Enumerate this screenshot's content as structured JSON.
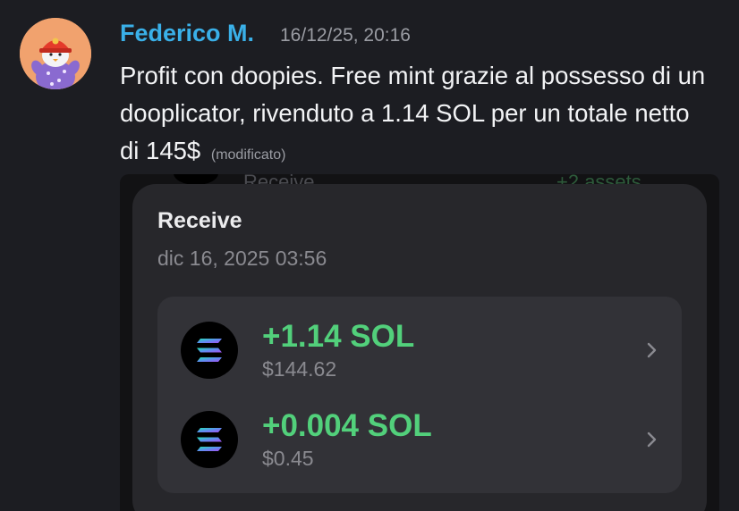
{
  "message": {
    "author": "Federico M.",
    "timestamp": "16/12/25, 20:16",
    "text": "Profit con doopies. Free mint grazie al possesso di un dooplicator, rivenduto a 1.14 SOL per un totale netto di 145$",
    "edited_label": "(modificato)"
  },
  "attachment": {
    "peek_left_text": "Receive",
    "peek_right_text": "+2 assets",
    "title": "Receive",
    "date": "dic 16, 2025 03:56",
    "transactions": [
      {
        "amount": "+1.14 SOL",
        "usd": "$144.62",
        "icon": "solana-icon"
      },
      {
        "amount": "+0.004 SOL",
        "usd": "$0.45",
        "icon": "solana-icon"
      }
    ]
  },
  "colors": {
    "author": "#3ab0e8",
    "positive_amount": "#52d07b",
    "background": "#1c1d22",
    "avatar_bg": "#f1a26e"
  }
}
